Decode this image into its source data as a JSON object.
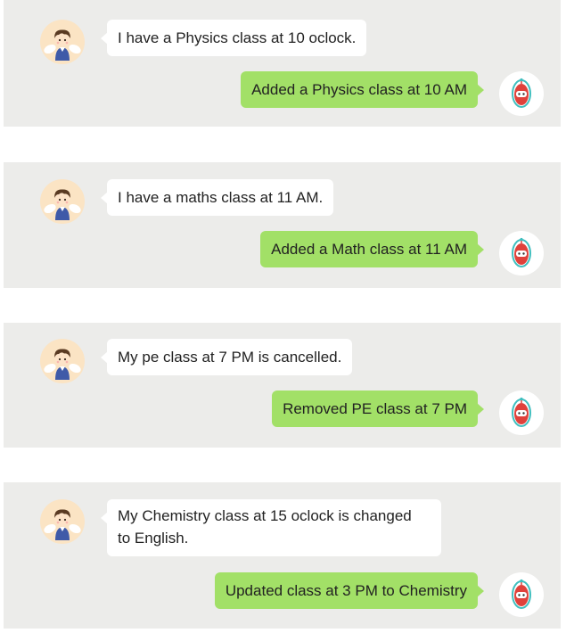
{
  "colors": {
    "panel_bg": "#ececea",
    "user_bubble": "#ffffff",
    "bot_bubble": "#a2e067",
    "user_avatar_bg": "#fbe4c4",
    "bot_avatar_bg": "#ffffff",
    "text": "#222222"
  },
  "icons": {
    "user_avatar": "cartoon-boy-with-wings",
    "bot_avatar": "red-robot-mascot"
  },
  "conversations": [
    {
      "user_message": "I have a Physics class at 10 oclock.",
      "bot_reply": "Added a Physics class at 10 AM"
    },
    {
      "user_message": "I have a maths class at 11 AM.",
      "bot_reply": "Added a Math class at 11 AM"
    },
    {
      "user_message": "My pe class at 7 PM is cancelled.",
      "bot_reply": "Removed PE class at 7 PM"
    },
    {
      "user_message_lines": [
        "My Chemistry class at 15 oclock is changed",
        "to English."
      ],
      "bot_reply": "Updated class at 3 PM to Chemistry"
    }
  ]
}
